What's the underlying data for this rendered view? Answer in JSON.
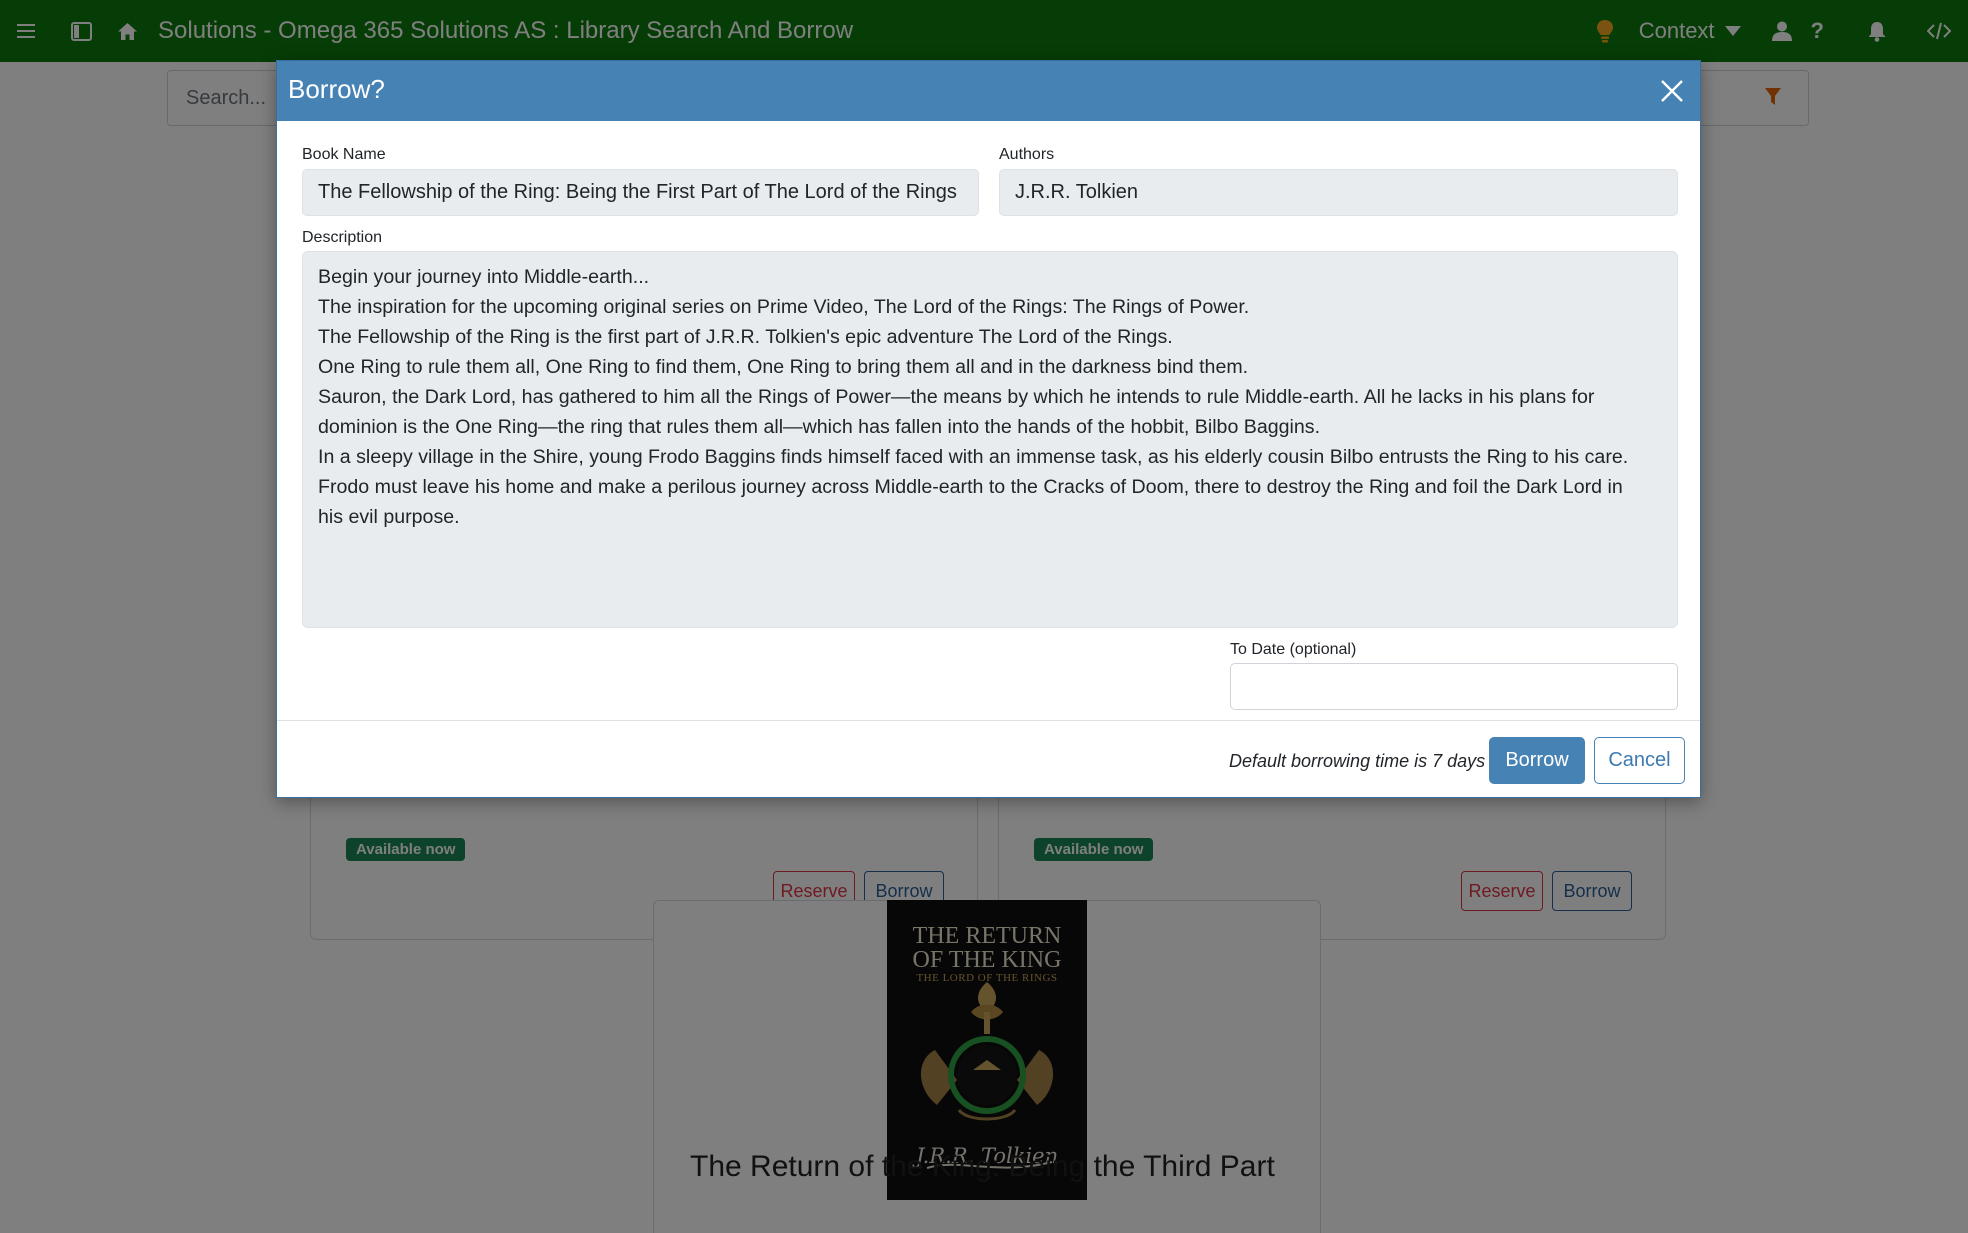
{
  "topbar": {
    "title": "Solutions - Omega 365 Solutions AS : Library Search And Borrow",
    "context_label": "Context",
    "help_label": "?"
  },
  "search": {
    "placeholder": "Search..."
  },
  "background_cards": {
    "availability_label": "Available now",
    "reserve_label": "Reserve",
    "borrow_label": "Borrow",
    "cover": {
      "title_line1": "THE RETURN",
      "title_line2": "OF THE KING",
      "subtitle": "THE LORD OF THE RINGS",
      "signature": "J.R.R. Tolkien"
    },
    "partial_title": "The Return of the King: Being the Third Part"
  },
  "modal": {
    "title": "Borrow?",
    "book_name_label": "Book Name",
    "book_name": "The Fellowship of the Ring: Being the First Part of The Lord of the Rings",
    "authors_label": "Authors",
    "authors": "J.R.R. Tolkien",
    "description_label": "Description",
    "description_lines": [
      "Begin your journey into Middle-earth...",
      "The inspiration for the upcoming original series on Prime Video, The Lord of the Rings: The Rings of Power.",
      "The Fellowship of the Ring is the first part of J.R.R. Tolkien's epic adventure The Lord of the Rings.",
      "One Ring to rule them all, One Ring to find them, One Ring to bring them all and in the darkness bind them.",
      "Sauron, the Dark Lord, has gathered to him all the Rings of Power—the means by which he intends to rule Middle-earth. All he lacks in his plans for",
      "dominion is the One Ring—the ring that rules them all—which has fallen into the hands of the hobbit, Bilbo Baggins.",
      "In a sleepy village in the Shire, young Frodo Baggins finds himself faced with an immense task, as his elderly cousin Bilbo entrusts the Ring to his care.",
      "Frodo must leave his home and make a perilous journey across Middle-earth to the Cracks of Doom, there to destroy the Ring and foil the Dark Lord in",
      "his evil purpose."
    ],
    "to_date_label": "To Date (optional)",
    "to_date_value": "",
    "footer_note": "Default borrowing time is 7 days",
    "borrow_button": "Borrow",
    "cancel_button": "Cancel"
  },
  "colors": {
    "topbar": "#0d7a0d",
    "modal_header": "#4682b4",
    "badge_available": "#198754",
    "reserve": "#dc3545",
    "filter_icon": "#e36209",
    "bulb_icon": "#f5a623"
  },
  "icons": [
    "hamburger-icon",
    "sidebar-toggle-icon",
    "home-icon",
    "lightbulb-icon",
    "dropdown-caret-icon",
    "user-icon",
    "help-icon",
    "bell-icon",
    "code-icon",
    "filter-icon",
    "close-icon"
  ]
}
